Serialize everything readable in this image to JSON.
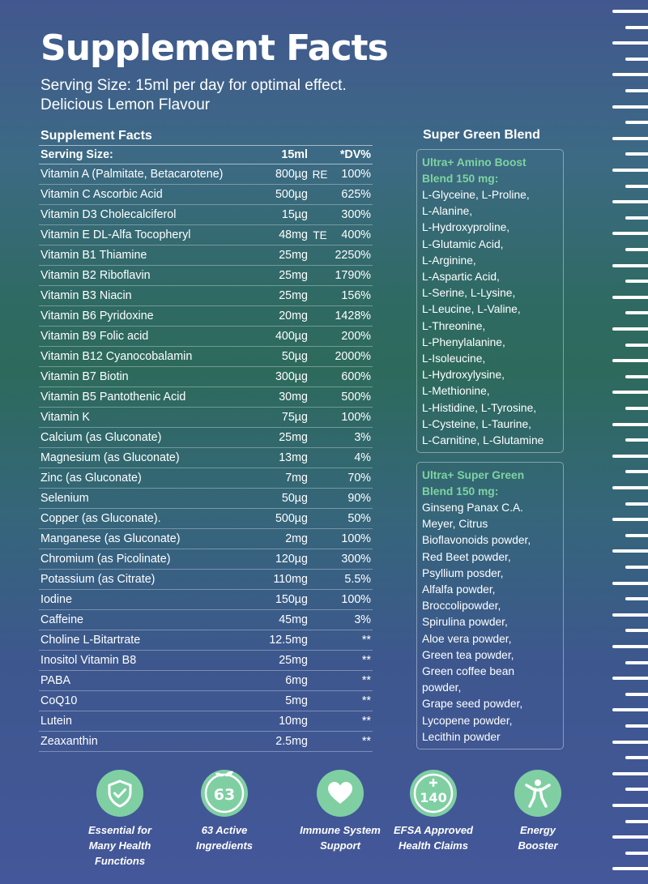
{
  "header": {
    "title": "Supplement Facts",
    "subtitle_line1": "Serving Size: 15ml per day for optimal effect.",
    "subtitle_line2": "Delicious Lemon Flavour"
  },
  "facts_table": {
    "heading": "Supplement Facts",
    "col_headers": {
      "name": "Serving Size:",
      "amount": "15ml",
      "dv": "*DV%"
    },
    "rows": [
      {
        "name": "Vitamin A (Palmitate, Betacarotene)",
        "amount": "800µg",
        "unit": "RE",
        "dv": "100%"
      },
      {
        "name": "Vitamin C Ascorbic Acid",
        "amount": "500µg",
        "unit": "",
        "dv": "625%"
      },
      {
        "name": "Vitamin D3 Cholecalciferol",
        "amount": "15µg",
        "unit": "",
        "dv": "300%"
      },
      {
        "name": "Vitamin E DL-Alfa Tocopheryl",
        "amount": "48mg",
        "unit": "TE",
        "dv": "400%"
      },
      {
        "name": "Vitamin B1 Thiamine",
        "amount": "25mg",
        "unit": "",
        "dv": "2250%"
      },
      {
        "name": "Vitamin B2 Riboflavin",
        "amount": "25mg",
        "unit": "",
        "dv": "1790%"
      },
      {
        "name": "Vitamin B3 Niacin",
        "amount": "25mg",
        "unit": "",
        "dv": "156%"
      },
      {
        "name": "Vitamin B6 Pyridoxine",
        "amount": "20mg",
        "unit": "",
        "dv": "1428%"
      },
      {
        "name": "Vitamin B9 Folic acid",
        "amount": "400µg",
        "unit": "",
        "dv": "200%"
      },
      {
        "name": "Vitamin B12 Cyanocobalamin",
        "amount": "50µg",
        "unit": "",
        "dv": "2000%"
      },
      {
        "name": "Vitamin B7 Biotin",
        "amount": "300µg",
        "unit": "",
        "dv": "600%"
      },
      {
        "name": "Vitamin B5 Pantothenic Acid",
        "amount": "30mg",
        "unit": "",
        "dv": "500%"
      },
      {
        "name": "Vitamin K",
        "amount": "75µg",
        "unit": "",
        "dv": "100%"
      },
      {
        "name": "Calcium (as Gluconate)",
        "amount": "25mg",
        "unit": "",
        "dv": "3%"
      },
      {
        "name": "Magnesium (as Gluconate)",
        "amount": "13mg",
        "unit": "",
        "dv": "4%"
      },
      {
        "name": "Zinc (as Gluconate)",
        "amount": "7mg",
        "unit": "",
        "dv": "70%"
      },
      {
        "name": "Selenium",
        "amount": "50µg",
        "unit": "",
        "dv": "90%"
      },
      {
        "name": "Copper (as Gluconate).",
        "amount": "500µg",
        "unit": "",
        "dv": "50%"
      },
      {
        "name": "Manganese (as Gluconate)",
        "amount": "2mg",
        "unit": "",
        "dv": "100%"
      },
      {
        "name": "Chromium (as Picolinate)",
        "amount": "120µg",
        "unit": "",
        "dv": "300%"
      },
      {
        "name": "Potassium (as Citrate)",
        "amount": "110mg",
        "unit": "",
        "dv": "5.5%"
      },
      {
        "name": "Iodine",
        "amount": "150µg",
        "unit": "",
        "dv": "100%"
      },
      {
        "name": "Caffeine",
        "amount": "45mg",
        "unit": "",
        "dv": "3%"
      },
      {
        "name": "Choline L-Bitartrate",
        "amount": "12.5mg",
        "unit": "",
        "dv": "**"
      },
      {
        "name": "Inositol Vitamin B8",
        "amount": "25mg",
        "unit": "",
        "dv": "**"
      },
      {
        "name": "PABA",
        "amount": "6mg",
        "unit": "",
        "dv": "**"
      },
      {
        "name": "CoQ10",
        "amount": "5mg",
        "unit": "",
        "dv": "**"
      },
      {
        "name": "Lutein",
        "amount": "10mg",
        "unit": "",
        "dv": "**"
      },
      {
        "name": "Zeaxanthin",
        "amount": "2.5mg",
        "unit": "",
        "dv": "**"
      }
    ]
  },
  "blend": {
    "heading": "Super Green Blend",
    "amino": {
      "title_line1": "Ultra+ Amino Boost",
      "title_line2": "Blend 150 mg:",
      "lines": [
        "L-Glyceine, L-Proline,",
        "L-Alanine,",
        "L-Hydroxyproline,",
        "L-Glutamic Acid,",
        "L-Arginine,",
        "L-Aspartic Acid,",
        "L-Serine, L-Lysine,",
        "L-Leucine, L-Valine,",
        "L-Threonine,",
        "L-Phenylalanine,",
        "L-Isoleucine,",
        "L-Hydroxylysine,",
        "L-Methionine,",
        "L-Histidine, L-Tyrosine,",
        "L-Cysteine, L-Taurine,",
        "L-Carnitine, L-Glutamine"
      ]
    },
    "green": {
      "title_line1": "Ultra+ Super Green",
      "title_line2": "Blend 150 mg:",
      "lines": [
        "Ginseng Panax C.A.",
        "Meyer, Citrus",
        "Bioflavonoids powder,",
        "Red Beet powder,",
        "Psyllium posder,",
        "Alfalfa powder,",
        "Broccolipowder,",
        "Spirulina powder,",
        "Aloe vera powder,",
        "Green tea powder,",
        "Green coffee bean",
        "powder,",
        "Grape seed powder,",
        "Lycopene powder,",
        "Lecithin powder"
      ]
    }
  },
  "badges": [
    {
      "icon": "shield-check-icon",
      "line1": "Essential for",
      "line2": "Many Health",
      "line3": "Functions"
    },
    {
      "icon": "leaf-63-icon",
      "icon_text": "63",
      "line1": "63 Active",
      "line2": "Ingredients",
      "line3": ""
    },
    {
      "icon": "heart-icon",
      "line1": "Immune System",
      "line2": "Support",
      "line3": ""
    },
    {
      "icon": "plus-140-icon",
      "icon_text": "140",
      "line1": "EFSA Approved",
      "line2": "Health Claims",
      "line3": ""
    },
    {
      "icon": "energy-person-icon",
      "line1": "Energy",
      "line2": "Booster",
      "line3": ""
    }
  ],
  "colors": {
    "accent_green": "#7ed3a0",
    "badge_circle": "#7fcfa3",
    "bg_top": "#42578f",
    "bg_mid": "#2d6a5c",
    "bg_bottom": "#44579a"
  }
}
